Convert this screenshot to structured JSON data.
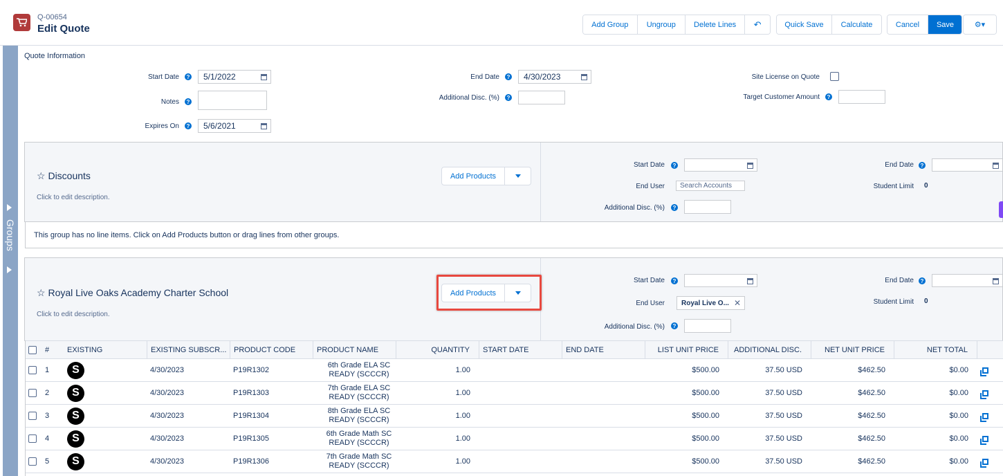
{
  "header": {
    "quote_id": "Q-00654",
    "title": "Edit Quote",
    "buttons": {
      "add_group": "Add Group",
      "ungroup": "Ungroup",
      "delete_lines": "Delete Lines",
      "undo": "↶",
      "quick_save": "Quick Save",
      "calculate": "Calculate",
      "cancel": "Cancel",
      "save": "Save",
      "settings": "⚙▾"
    }
  },
  "rail": {
    "label": "Groups"
  },
  "quote_info": {
    "title": "Quote Information",
    "start_date_label": "Start Date",
    "start_date": "5/1/2022",
    "end_date_label": "End Date",
    "end_date": "4/30/2023",
    "site_license_label": "Site License on Quote",
    "notes_label": "Notes",
    "additional_disc_label": "Additional Disc. (%)",
    "target_amount_label": "Target Customer Amount",
    "expires_on_label": "Expires On",
    "expires_on": "5/6/2021",
    "help": "?"
  },
  "groups": [
    {
      "name": "Discounts",
      "star": "☆",
      "description": "Click to edit description.",
      "add_products": "Add Products",
      "start_date_label": "Start Date",
      "end_date_label": "End Date",
      "end_user_label": "End User",
      "end_user_placeholder": "Search Accounts",
      "student_limit_label": "Student Limit",
      "student_limit": "0",
      "additional_disc_label": "Additional Disc. (%)",
      "empty_message": "This group has no line items. Click on Add Products button or drag lines from other groups."
    },
    {
      "name": "Royal Live Oaks Academy Charter School",
      "star": "☆",
      "description": "Click to edit description.",
      "add_products": "Add Products",
      "start_date_label": "Start Date",
      "end_date_label": "End Date",
      "end_user_label": "End User",
      "end_user_value": "Royal Live O...",
      "end_user_clear": "✕",
      "student_limit_label": "Student Limit",
      "student_limit": "0",
      "additional_disc_label": "Additional Disc. (%)"
    }
  ],
  "table": {
    "columns": {
      "num": "#",
      "existing": "EXISTING",
      "existing_sub": "EXISTING SUBSCR...",
      "product_code": "PRODUCT CODE",
      "product_name": "PRODUCT NAME",
      "quantity": "QUANTITY",
      "start_date": "START DATE",
      "end_date": "END DATE",
      "list_unit_price": "LIST UNIT PRICE",
      "additional_disc": "ADDITIONAL DISC.",
      "net_unit_price": "NET UNIT PRICE",
      "net_total": "NET TOTAL"
    },
    "rows": [
      {
        "num": "1",
        "badge": "S",
        "existing_sub": "4/30/2023",
        "product_code": "P19R1302",
        "product_name": "6th Grade ELA SC READY (SCCCR)",
        "quantity": "1.00",
        "list_unit_price": "$500.00",
        "additional_disc": "37.50 USD",
        "net_unit_price": "$462.50",
        "net_total": "$0.00"
      },
      {
        "num": "2",
        "badge": "S",
        "existing_sub": "4/30/2023",
        "product_code": "P19R1303",
        "product_name": "7th Grade ELA SC READY (SCCCR)",
        "quantity": "1.00",
        "list_unit_price": "$500.00",
        "additional_disc": "37.50 USD",
        "net_unit_price": "$462.50",
        "net_total": "$0.00"
      },
      {
        "num": "3",
        "badge": "S",
        "existing_sub": "4/30/2023",
        "product_code": "P19R1304",
        "product_name": "8th Grade ELA SC READY (SCCCR)",
        "quantity": "1.00",
        "list_unit_price": "$500.00",
        "additional_disc": "37.50 USD",
        "net_unit_price": "$462.50",
        "net_total": "$0.00"
      },
      {
        "num": "4",
        "badge": "S",
        "existing_sub": "4/30/2023",
        "product_code": "P19R1305",
        "product_name": "6th Grade Math SC READY (SCCCR)",
        "quantity": "1.00",
        "list_unit_price": "$500.00",
        "additional_disc": "37.50 USD",
        "net_unit_price": "$462.50",
        "net_total": "$0.00"
      },
      {
        "num": "5",
        "badge": "S",
        "existing_sub": "4/30/2023",
        "product_code": "P19R1306",
        "product_name": "7th Grade Math SC READY (SCCCR)",
        "quantity": "1.00",
        "list_unit_price": "$500.00",
        "additional_disc": "37.50 USD",
        "net_unit_price": "$462.50",
        "net_total": "$0.00"
      }
    ]
  },
  "colors": {
    "accent": "#0070d2",
    "highlight": "#e8483f",
    "rail": "#8ba5c6",
    "quote_icon": "#b03a3a"
  }
}
